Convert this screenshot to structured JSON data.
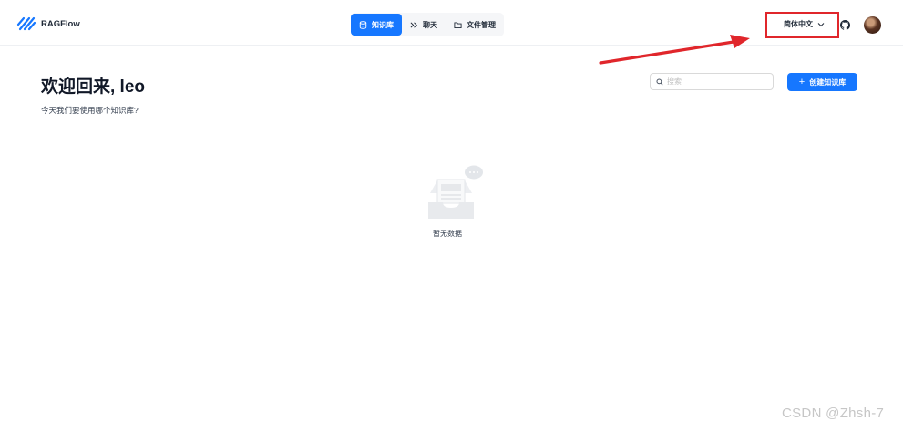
{
  "app": {
    "name": "RAGFlow"
  },
  "nav": {
    "tabs": [
      {
        "label": "知识库",
        "icon": "database-icon",
        "active": true
      },
      {
        "label": "聊天",
        "icon": "chat-icon",
        "active": false
      },
      {
        "label": "文件管理",
        "icon": "folder-icon",
        "active": false
      }
    ]
  },
  "header": {
    "language": "简体中文",
    "github_icon": "github-icon",
    "avatar": "user-avatar"
  },
  "main": {
    "welcome": "欢迎回来, leo",
    "subtitle": "今天我们要使用哪个知识库?",
    "search_placeholder": "搜索",
    "create_button": "创建知识库",
    "empty_text": "暂无数据"
  },
  "watermark": "CSDN @Zhsh-7",
  "colors": {
    "accent": "#1677ff",
    "annotation": "#e0262b"
  }
}
